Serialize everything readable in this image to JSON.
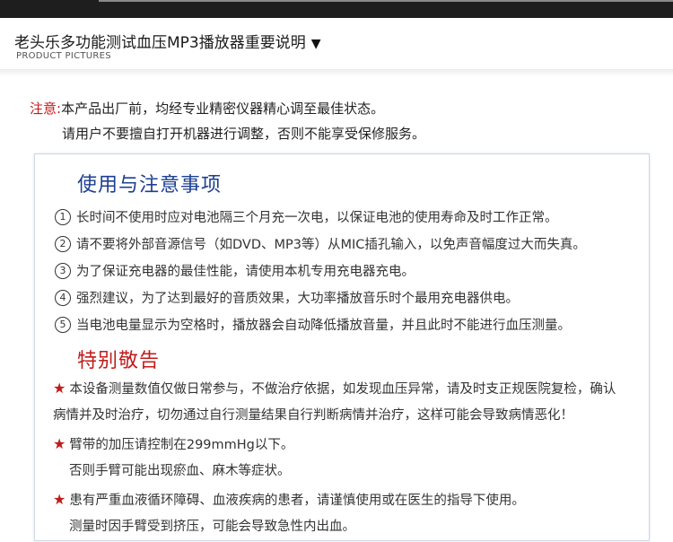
{
  "header": {
    "title": "老头乐多功能测试血压MP3播放器重要说明",
    "title_arrow": "▼",
    "subtitle": "PRODUCT PICTURES"
  },
  "notice": {
    "label": "注意:",
    "line1": "本产品出厂前，均经专业精密仪器精心调至最佳状态。",
    "line2": "请用户不要擅自打开机器进行调整，否则不能享受保修服务。"
  },
  "usage": {
    "title": "使用与注意事项",
    "items": [
      {
        "num": "1",
        "text": "长时间不使用时应对电池隔三个月充一次电，以保证电池的使用寿命及时工作正常。"
      },
      {
        "num": "2",
        "text": "请不要将外部音源信号（如DVD、MP3等）从MIC插孔输入，以免声音幅度过大而失真。"
      },
      {
        "num": "3",
        "text": "为了保证充电器的最佳性能，请使用本机专用充电器充电。"
      },
      {
        "num": "4",
        "text": "强烈建议，为了达到最好的音质效果，大功率播放音乐时个最用充电器供电。"
      },
      {
        "num": "5",
        "text": "当电池电量显示为空格时，播放器会自动降低播放音量，并且此时不能进行血压测量。"
      }
    ]
  },
  "special": {
    "title": "特别敬告",
    "star": "★",
    "items": [
      {
        "first": "本设备测量数值仅做日常参与，不做治疗依据，如发现血压异常，请及时支正规医院复检，确认",
        "second": "病情并及时治疗，切勿通过自行测量结果自行判断病情并治疗，这样可能会导致病情恶化！"
      },
      {
        "first": "臂带的加压请控制在299mmHg以下。",
        "second": "否则手臂可能出现瘀血、麻木等症状。"
      },
      {
        "first": "患有严重血液循环障碍、血液疾病的患者，请谨慎使用或在医生的指导下使用。",
        "second": "测量时因手臂受到挤压，可能会导致急性内出血。"
      }
    ]
  },
  "colors": {
    "blue_heading": "#1d3f91",
    "red_heading": "#c21a1a",
    "top_band": "#1e1e1e"
  }
}
